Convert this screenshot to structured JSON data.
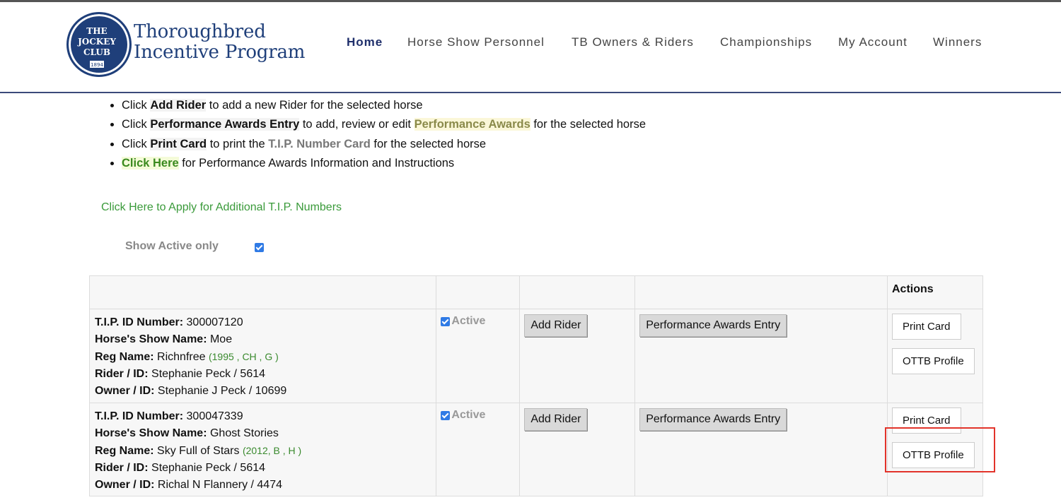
{
  "logo": {
    "seal_lines": [
      "THE",
      "JOCKEY",
      "CLUB",
      "1894"
    ],
    "title_line1": "Thoroughbred",
    "title_line2": "Incentive Program"
  },
  "nav": {
    "home": "Home",
    "personnel": "Horse Show Personnel",
    "owners": "TB Owners & Riders",
    "championships": "Championships",
    "account": "My Account",
    "winners": "Winners"
  },
  "instructions": {
    "i1_pre": "Click ",
    "i1_key": "Add Rider",
    "i1_post": " to add a new Rider for the selected horse",
    "i2_pre": "Click ",
    "i2_key": "Performance Awards Entry",
    "i2_mid": " to add, review or edit ",
    "i2_key2": "Performance Awards",
    "i2_post": " for the selected horse",
    "i3_pre": "Click ",
    "i3_key": "Print Card",
    "i3_mid": " to print the ",
    "i3_key2": "T.I.P. Number Card",
    "i3_post": " for the selected horse",
    "i4_key": "Click Here",
    "i4_post": " for Performance Awards Information and Instructions"
  },
  "apply_link": "Click Here to Apply for Additional T.I.P. Numbers",
  "filter": {
    "show_active_label": "Show Active only",
    "checked": true
  },
  "table": {
    "actions_header": "Actions",
    "labels": {
      "tip": "T.I.P. ID Number:",
      "show_name": "Horse's Show Name:",
      "reg_name": "Reg Name:",
      "rider": "Rider / ID:",
      "owner": "Owner / ID:"
    },
    "rows": [
      {
        "tip": "300007120",
        "show_name": "Moe",
        "reg_name": "Richnfree",
        "reg_detail": "(1995 , CH , G )",
        "rider": "Stephanie Peck / 5614",
        "owner": "Stephanie J Peck / 10699",
        "status": "Active",
        "add_rider": "Add Rider",
        "perf": "Performance Awards Entry",
        "print": "Print Card",
        "ottb": "OTTB Profile"
      },
      {
        "tip": "300047339",
        "show_name": "Ghost Stories",
        "reg_name": "Sky Full of Stars",
        "reg_detail": "(2012, B , H )",
        "rider": "Stephanie Peck / 5614",
        "owner": "Richal N Flannery / 4474",
        "status": "Active",
        "add_rider": "Add Rider",
        "perf": "Performance Awards Entry",
        "print": "Print Card",
        "ottb": "OTTB Profile"
      }
    ]
  },
  "colors": {
    "brand_navy": "#1f3f7a",
    "link_green": "#3a9a3a",
    "highlight_red": "#e2332a"
  }
}
